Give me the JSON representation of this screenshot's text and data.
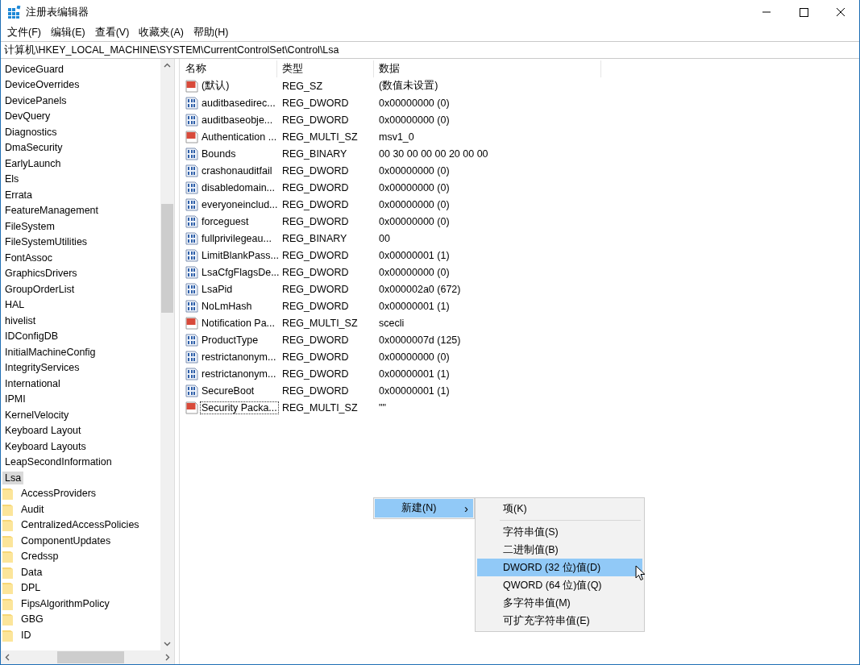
{
  "window": {
    "title": "注册表编辑器"
  },
  "menu": [
    "文件(F)",
    "编辑(E)",
    "查看(V)",
    "收藏夹(A)",
    "帮助(H)"
  ],
  "address": "计算机\\HKEY_LOCAL_MACHINE\\SYSTEM\\CurrentControlSet\\Control\\Lsa",
  "tree": [
    {
      "label": "DeviceGuard",
      "selected": false
    },
    {
      "label": "DeviceOverrides",
      "selected": false
    },
    {
      "label": "DevicePanels",
      "selected": false
    },
    {
      "label": "DevQuery",
      "selected": false
    },
    {
      "label": "Diagnostics",
      "selected": false
    },
    {
      "label": "DmaSecurity",
      "selected": false
    },
    {
      "label": "EarlyLaunch",
      "selected": false
    },
    {
      "label": "Els",
      "selected": false
    },
    {
      "label": "Errata",
      "selected": false
    },
    {
      "label": "FeatureManagement",
      "selected": false
    },
    {
      "label": "FileSystem",
      "selected": false
    },
    {
      "label": "FileSystemUtilities",
      "selected": false
    },
    {
      "label": "FontAssoc",
      "selected": false
    },
    {
      "label": "GraphicsDrivers",
      "selected": false
    },
    {
      "label": "GroupOrderList",
      "selected": false
    },
    {
      "label": "HAL",
      "selected": false
    },
    {
      "label": "hivelist",
      "selected": false
    },
    {
      "label": "IDConfigDB",
      "selected": false
    },
    {
      "label": "InitialMachineConfig",
      "selected": false
    },
    {
      "label": "IntegrityServices",
      "selected": false
    },
    {
      "label": "International",
      "selected": false
    },
    {
      "label": "IPMI",
      "selected": false
    },
    {
      "label": "KernelVelocity",
      "selected": false
    },
    {
      "label": "Keyboard Layout",
      "selected": false
    },
    {
      "label": "Keyboard Layouts",
      "selected": false
    },
    {
      "label": "LeapSecondInformation",
      "selected": false
    },
    {
      "label": "Lsa",
      "selected": true,
      "children": [
        {
          "label": "AccessProviders",
          "selected": false
        },
        {
          "label": "Audit",
          "selected": false
        },
        {
          "label": "CentralizedAccessPolicies",
          "selected": false
        },
        {
          "label": "ComponentUpdates",
          "selected": false
        },
        {
          "label": "Credssp",
          "selected": false
        },
        {
          "label": "Data",
          "selected": false
        },
        {
          "label": "DPL",
          "selected": false
        },
        {
          "label": "FipsAlgorithmPolicy",
          "selected": false
        },
        {
          "label": "GBG",
          "selected": false
        },
        {
          "label": "ID",
          "selected": false
        }
      ]
    }
  ],
  "table": {
    "columns": [
      "名称",
      "类型",
      "数据"
    ],
    "rows": [
      {
        "kind": "string",
        "name": "(默认)",
        "type": "REG_SZ",
        "data": "(数值未设置)",
        "focused": false
      },
      {
        "kind": "binary",
        "name": "auditbasedirec...",
        "type": "REG_DWORD",
        "data": "0x00000000 (0)",
        "focused": false
      },
      {
        "kind": "binary",
        "name": "auditbaseobje...",
        "type": "REG_DWORD",
        "data": "0x00000000 (0)",
        "focused": false
      },
      {
        "kind": "string",
        "name": "Authentication ...",
        "type": "REG_MULTI_SZ",
        "data": "msv1_0",
        "focused": false
      },
      {
        "kind": "binary",
        "name": "Bounds",
        "type": "REG_BINARY",
        "data": "00 30 00 00 00 20 00 00",
        "focused": false
      },
      {
        "kind": "binary",
        "name": "crashonauditfail",
        "type": "REG_DWORD",
        "data": "0x00000000 (0)",
        "focused": false
      },
      {
        "kind": "binary",
        "name": "disabledomain...",
        "type": "REG_DWORD",
        "data": "0x00000000 (0)",
        "focused": false
      },
      {
        "kind": "binary",
        "name": "everyoneinclud...",
        "type": "REG_DWORD",
        "data": "0x00000000 (0)",
        "focused": false
      },
      {
        "kind": "binary",
        "name": "forceguest",
        "type": "REG_DWORD",
        "data": "0x00000000 (0)",
        "focused": false
      },
      {
        "kind": "binary",
        "name": "fullprivilegeau...",
        "type": "REG_BINARY",
        "data": "00",
        "focused": false
      },
      {
        "kind": "binary",
        "name": "LimitBlankPass...",
        "type": "REG_DWORD",
        "data": "0x00000001 (1)",
        "focused": false
      },
      {
        "kind": "binary",
        "name": "LsaCfgFlagsDe...",
        "type": "REG_DWORD",
        "data": "0x00000000 (0)",
        "focused": false
      },
      {
        "kind": "binary",
        "name": "LsaPid",
        "type": "REG_DWORD",
        "data": "0x000002a0 (672)",
        "focused": false
      },
      {
        "kind": "binary",
        "name": "NoLmHash",
        "type": "REG_DWORD",
        "data": "0x00000001 (1)",
        "focused": false
      },
      {
        "kind": "string",
        "name": "Notification Pa...",
        "type": "REG_MULTI_SZ",
        "data": "scecli",
        "focused": false
      },
      {
        "kind": "binary",
        "name": "ProductType",
        "type": "REG_DWORD",
        "data": "0x0000007d (125)",
        "focused": false
      },
      {
        "kind": "binary",
        "name": "restrictanonym...",
        "type": "REG_DWORD",
        "data": "0x00000000 (0)",
        "focused": false
      },
      {
        "kind": "binary",
        "name": "restrictanonym...",
        "type": "REG_DWORD",
        "data": "0x00000001 (1)",
        "focused": false
      },
      {
        "kind": "binary",
        "name": "SecureBoot",
        "type": "REG_DWORD",
        "data": "0x00000001 (1)",
        "focused": false
      },
      {
        "kind": "string",
        "name": "Security Packa...",
        "type": "REG_MULTI_SZ",
        "data": "\"\"",
        "focused": true
      }
    ]
  },
  "context_menu": {
    "items": [
      {
        "label": "新建(N)",
        "arrow": "›",
        "selected": true
      }
    ],
    "submenu": [
      {
        "kind": "item",
        "label": "项(K)",
        "selected": false
      },
      {
        "kind": "separator"
      },
      {
        "kind": "item",
        "label": "字符串值(S)",
        "selected": false
      },
      {
        "kind": "item",
        "label": "二进制值(B)",
        "selected": false
      },
      {
        "kind": "item",
        "label": "DWORD (32 位)值(D)",
        "selected": true
      },
      {
        "kind": "item",
        "label": "QWORD (64 位)值(Q)",
        "selected": false
      },
      {
        "kind": "item",
        "label": "多字符串值(M)",
        "selected": false
      },
      {
        "kind": "item",
        "label": "可扩充字符串值(E)",
        "selected": false
      }
    ]
  }
}
